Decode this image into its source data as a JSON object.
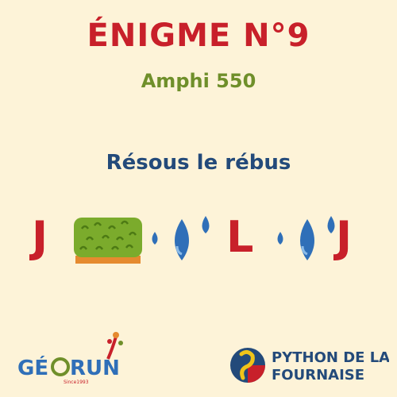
{
  "header": {
    "title": "ÉNIGME N°9",
    "subtitle": "Amphi 550"
  },
  "puzzle": {
    "instruction": "Résous le rébus",
    "letters": [
      "J",
      "L",
      "J"
    ],
    "images": [
      "hedge-icon",
      "water-drops-icon",
      "water-drops-icon"
    ]
  },
  "logos": {
    "left": "GÉORUN",
    "left_tagline": "Since 1993",
    "right_line1": "PYTHON DE LA",
    "right_line2": "FOURNAISE"
  },
  "colors": {
    "background": "#fdf3d8",
    "title": "#c8202a",
    "subtitle": "#6f8f2a",
    "instruction": "#234a7a",
    "drop": "#2f6fb8"
  }
}
